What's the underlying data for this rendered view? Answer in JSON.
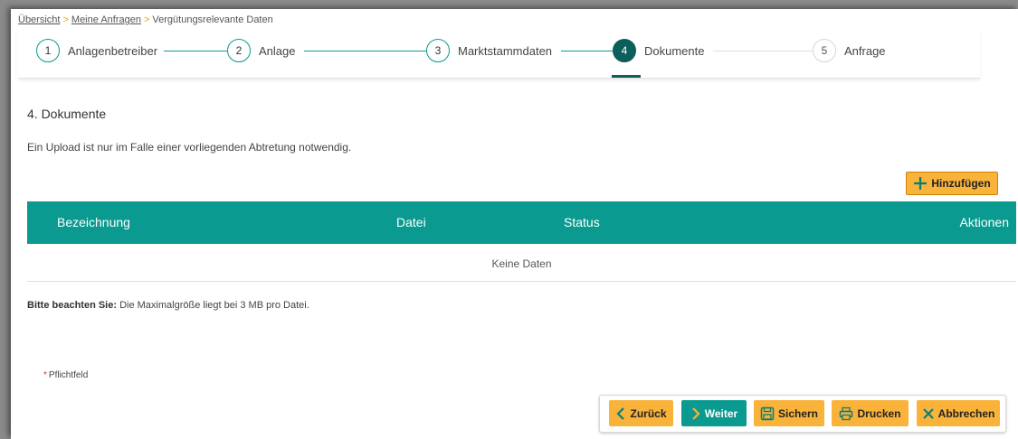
{
  "breadcrumb": {
    "items": [
      "Übersicht",
      "Meine Anfragen",
      "Vergütungsrelevante Daten"
    ],
    "separator": ">"
  },
  "steps": [
    {
      "number": "1",
      "label": "Anlagenbetreiber",
      "state": "done"
    },
    {
      "number": "2",
      "label": "Anlage",
      "state": "done"
    },
    {
      "number": "3",
      "label": "Marktstammdaten",
      "state": "done"
    },
    {
      "number": "4",
      "label": "Dokumente",
      "state": "active"
    },
    {
      "number": "5",
      "label": "Anfrage",
      "state": "pending"
    }
  ],
  "section": {
    "title": "4. Dokumente",
    "info": "Ein Upload ist nur im Falle einer vorliegenden Abtretung notwendig."
  },
  "add_button": {
    "label": "Hinzufügen",
    "icon": "plus-icon"
  },
  "table": {
    "columns": [
      "Bezeichnung",
      "Datei",
      "Status",
      "Aktionen"
    ],
    "empty_text": "Keine Daten"
  },
  "note": {
    "label": "Bitte beachten Sie:",
    "text": " Die Maximalgröße liegt bei 3 MB pro Datei."
  },
  "required": {
    "star": "*",
    "label": "Pflichtfeld"
  },
  "actions": [
    {
      "label": "Zurück",
      "icon": "chevron-left-icon",
      "style": "orange"
    },
    {
      "label": "Weiter",
      "icon": "chevron-right-icon",
      "style": "teal"
    },
    {
      "label": "Sichern",
      "icon": "save-icon",
      "style": "orange"
    },
    {
      "label": "Drucken",
      "icon": "print-icon",
      "style": "orange"
    },
    {
      "label": "Abbrechen",
      "icon": "close-icon",
      "style": "orange"
    }
  ],
  "colors": {
    "teal": "#0a9a90",
    "dark_teal": "#0b5e5a",
    "orange": "#f9b23a"
  }
}
